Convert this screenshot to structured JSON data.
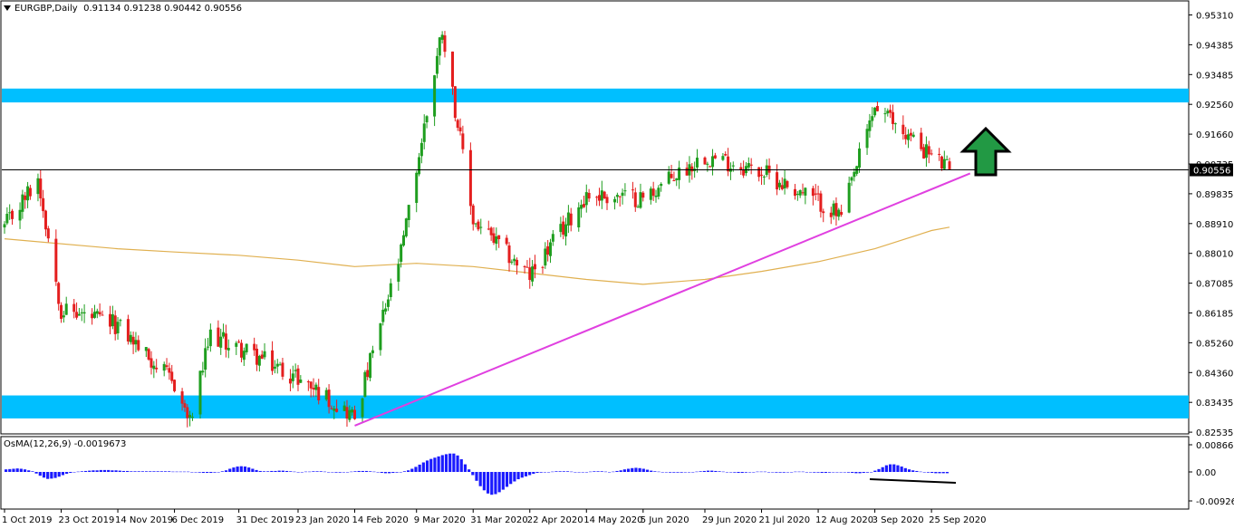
{
  "header": {
    "symbol": "EURGBP,Daily",
    "ohlc": "0.91134 0.91238 0.90442 0.90556"
  },
  "osma": {
    "label": "OsMA(12,26,9) -0.0019673",
    "ticks": [
      "0.0086635",
      "0.00",
      "-0.009266"
    ]
  },
  "price_axis": {
    "ticks": [
      "0.95310",
      "0.94385",
      "0.93485",
      "0.92560",
      "0.91660",
      "0.90735",
      "0.89835",
      "0.88910",
      "0.88010",
      "0.87085",
      "0.86185",
      "0.85260",
      "0.84360",
      "0.83435",
      "0.82535"
    ],
    "current_price": "0.90556"
  },
  "date_axis": {
    "ticks": [
      "1 Oct 2019",
      "23 Oct 2019",
      "14 Nov 2019",
      "6 Dec 2019",
      "31 Dec 2019",
      "23 Jan 2020",
      "14 Feb 2020",
      "9 Mar 2020",
      "31 Mar 2020",
      "22 Apr 2020",
      "14 May 2020",
      "5 Jun 2020",
      "29 Jun 2020",
      "21 Jul 2020",
      "12 Aug 2020",
      "3 Sep 2020",
      "25 Sep 2020"
    ]
  },
  "colors": {
    "bull": "#1f9e1f",
    "bear": "#e41e1e",
    "zone": "#00bfff",
    "trendline": "#e040e0",
    "ma": "#e0b050",
    "histogram": "#1a1aff",
    "arrow": "#229944"
  },
  "chart_data": [
    {
      "type": "candlestick",
      "symbol": "EURGBP",
      "timeframe": "Daily",
      "ylim": [
        0.8225,
        0.956
      ],
      "key_points": [
        {
          "date": "1 Oct 2019",
          "price": 0.888
        },
        {
          "date": "14 Oct 2019",
          "price": 0.903
        },
        {
          "date": "23 Oct 2019",
          "price": 0.863
        },
        {
          "date": "14 Nov 2019",
          "price": 0.858
        },
        {
          "date": "6 Dec 2019",
          "price": 0.84
        },
        {
          "date": "12 Dec 2019",
          "price": 0.828
        },
        {
          "date": "20 Dec 2019",
          "price": 0.855
        },
        {
          "date": "31 Dec 2019",
          "price": 0.851
        },
        {
          "date": "23 Jan 2020",
          "price": 0.842
        },
        {
          "date": "14 Feb 2020",
          "price": 0.83
        },
        {
          "date": "3 Mar 2020",
          "price": 0.88
        },
        {
          "date": "19 Mar 2020",
          "price": 0.949
        },
        {
          "date": "31 Mar 2020",
          "price": 0.89
        },
        {
          "date": "22 Apr 2020",
          "price": 0.873
        },
        {
          "date": "14 May 2020",
          "price": 0.898
        },
        {
          "date": "5 Jun 2020",
          "price": 0.897
        },
        {
          "date": "29 Jun 2020",
          "price": 0.91
        },
        {
          "date": "21 Jul 2020",
          "price": 0.905
        },
        {
          "date": "12 Aug 2020",
          "price": 0.896
        },
        {
          "date": "21 Aug 2020",
          "price": 0.891
        },
        {
          "date": "3 Sep 2020",
          "price": 0.925
        },
        {
          "date": "25 Sep 2020",
          "price": 0.91
        },
        {
          "date": "2 Oct 2020",
          "price": 0.9056
        }
      ],
      "resistance_zone": [
        0.9262,
        0.9305
      ],
      "support_zone": [
        0.8295,
        0.8365
      ],
      "current_price_line": 0.90556,
      "trendline": [
        {
          "date": "14 Feb 2020",
          "price": 0.8273
        },
        {
          "date": "10 Oct 2020",
          "price": 0.9045
        }
      ],
      "moving_average": [
        {
          "date": "1 Oct 2019",
          "price": 0.8845
        },
        {
          "date": "14 Nov 2019",
          "price": 0.8815
        },
        {
          "date": "6 Dec 2019",
          "price": 0.8805
        },
        {
          "date": "31 Dec 2019",
          "price": 0.8795
        },
        {
          "date": "23 Jan 2020",
          "price": 0.878
        },
        {
          "date": "14 Feb 2020",
          "price": 0.876
        },
        {
          "date": "9 Mar 2020",
          "price": 0.877
        },
        {
          "date": "31 Mar 2020",
          "price": 0.876
        },
        {
          "date": "22 Apr 2020",
          "price": 0.874
        },
        {
          "date": "14 May 2020",
          "price": 0.872
        },
        {
          "date": "5 Jun 2020",
          "price": 0.8705
        },
        {
          "date": "29 Jun 2020",
          "price": 0.872
        },
        {
          "date": "21 Jul 2020",
          "price": 0.8745
        },
        {
          "date": "12 Aug 2020",
          "price": 0.8775
        },
        {
          "date": "3 Sep 2020",
          "price": 0.8815
        },
        {
          "date": "25 Sep 2020",
          "price": 0.887
        },
        {
          "date": "2 Oct 2020",
          "price": 0.888
        }
      ]
    },
    {
      "type": "bar",
      "name": "OsMA(12,26,9)",
      "ylim": [
        -0.011,
        0.0095
      ],
      "values": [
        0.0008,
        0.0009,
        0.001,
        0.0011,
        0.001,
        0.0008,
        0.0005,
        0.0002,
        -0.0005,
        -0.0012,
        -0.0018,
        -0.0022,
        -0.0021,
        -0.0019,
        -0.0015,
        -0.001,
        -0.0006,
        -0.0003,
        -0.0001,
        0.0001,
        0.0002,
        0.0003,
        0.0004,
        0.0005,
        0.0005,
        0.0006,
        0.0006,
        0.0006,
        0.0005,
        0.0005,
        0.0004,
        0.0003,
        0.0003,
        0.0002,
        0.0002,
        0.0002,
        0.0002,
        0.0002,
        0.0002,
        0.0002,
        0.0002,
        0.0002,
        0.0002,
        0.0002,
        0.0001,
        0.0001,
        0.0001,
        0.0001,
        0.0001,
        0.0,
        -0.0001,
        -0.0002,
        -0.0003,
        -0.0003,
        -0.0003,
        -0.0002,
        -0.0001,
        0.0002,
        0.0005,
        0.001,
        0.0014,
        0.0017,
        0.0018,
        0.0017,
        0.0014,
        0.001,
        0.0006,
        0.0003,
        0.0002,
        0.0002,
        0.0003,
        0.0003,
        0.0004,
        0.0004,
        0.0003,
        0.0002,
        0.0001,
        0.0,
        0.0,
        0.0001,
        0.0001,
        0.0002,
        0.0002,
        0.0002,
        0.0001,
        0.0,
        -0.0001,
        -0.0002,
        -0.0002,
        -0.0001,
        0.0,
        0.0001,
        0.0002,
        0.0003,
        0.0003,
        0.0003,
        0.0002,
        0.0001,
        -0.0001,
        -0.0003,
        -0.0004,
        -0.0004,
        -0.0003,
        -0.0002,
        -0.0001,
        0.0002,
        0.0005,
        0.001,
        0.0016,
        0.0023,
        0.003,
        0.0036,
        0.0041,
        0.0045,
        0.0049,
        0.0053,
        0.0056,
        0.0058,
        0.0058,
        0.0052,
        0.004,
        0.0024,
        0.0008,
        -0.001,
        -0.0028,
        -0.0045,
        -0.0058,
        -0.0068,
        -0.0072,
        -0.007,
        -0.0064,
        -0.0056,
        -0.0047,
        -0.0038,
        -0.003,
        -0.0023,
        -0.0018,
        -0.0014,
        -0.001,
        -0.0006,
        -0.0003,
        -0.0002,
        -0.0001,
        0.0,
        0.0001,
        0.0002,
        0.0002,
        0.0002,
        0.0002,
        0.0001,
        0.0,
        -0.0001,
        -0.0001,
        0.0,
        0.0001,
        0.0002,
        0.0002,
        0.0002,
        0.0001,
        0.0,
        0.0001,
        0.0003,
        0.0005,
        0.0008,
        0.001,
        0.0012,
        0.0013,
        0.0012,
        0.001,
        0.0007,
        0.0004,
        0.0002,
        0.0001,
        0.0,
        -0.0001,
        -0.0002,
        -0.0002,
        -0.0002,
        -0.0002,
        -0.0001,
        0.0,
        0.0,
        0.0001,
        0.0002,
        0.0003,
        0.0004,
        0.0004,
        0.0003,
        0.0002,
        0.0001,
        0.0,
        -0.0001,
        -0.0002,
        -0.0003,
        -0.0003,
        -0.0002,
        -0.0001,
        0.0,
        0.0001,
        0.0001,
        0.0001,
        0.0,
        -0.0001,
        -0.0002,
        -0.0002,
        -0.0002,
        -0.0001,
        0.0,
        0.0001,
        0.0001,
        0.0001,
        0.0,
        -0.0001,
        -0.0002,
        -0.0002,
        -0.0003,
        -0.0003,
        -0.0002,
        -0.0001,
        0.0,
        0.0,
        -0.0001,
        -0.0002,
        -0.0003,
        -0.0004,
        -0.0004,
        -0.0003,
        -0.0002,
        0.0,
        0.0004,
        0.0009,
        0.0015,
        0.0021,
        0.0024,
        0.0024,
        0.0021,
        0.0017,
        0.0012,
        0.0008,
        0.0005,
        0.0003,
        0.0001,
        -0.0001,
        -0.0002,
        -0.0003,
        -0.0004,
        -0.0004,
        -0.0004,
        -0.0004
      ]
    }
  ]
}
